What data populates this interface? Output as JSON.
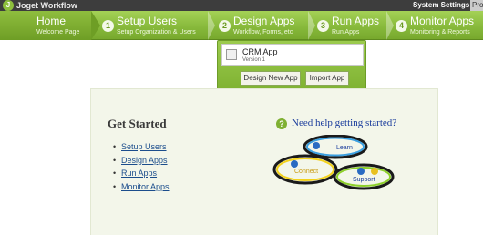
{
  "topbar": {
    "logo_letter": "J",
    "app_title": "Joget Workflow",
    "system_settings": "System Settings",
    "extra": "Pro"
  },
  "nav": [
    {
      "num": "",
      "label": "Home",
      "sub": "Welcome Page"
    },
    {
      "num": "1",
      "label": "Setup Users",
      "sub": "Setup Organization & Users"
    },
    {
      "num": "2",
      "label": "Design Apps",
      "sub": "Workflow, Forms, etc"
    },
    {
      "num": "3",
      "label": "Run Apps",
      "sub": "Run Apps"
    },
    {
      "num": "4",
      "label": "Monitor Apps",
      "sub": "Monitoring & Reports"
    }
  ],
  "dropdown": {
    "app_name": "CRM App",
    "app_version": "Version 1",
    "design_new_app": "Design New App",
    "import_app": "Import App"
  },
  "get_started": {
    "title": "Get Started",
    "links": [
      "Setup Users",
      "Design Apps",
      "Run Apps",
      "Monitor Apps"
    ],
    "help_text": "Need help getting started?",
    "help_icon": "?",
    "diagram": {
      "learn": "Learn",
      "connect": "Connect",
      "support": "Support"
    }
  },
  "colors": {
    "accent": "#8dbf3c",
    "link": "#1b4d8c",
    "panel": "#f3f6ea"
  }
}
